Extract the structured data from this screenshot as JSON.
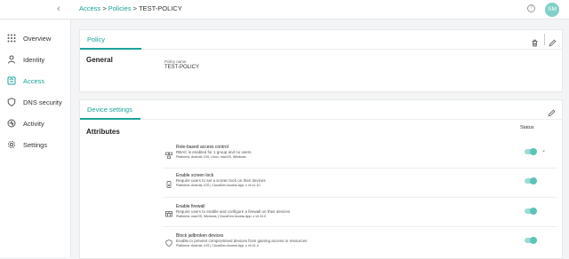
{
  "breadcrumb": {
    "access": "Access",
    "sep1": " > ",
    "policies": "Policies",
    "sep2": " > ",
    "current": "TEST-POLICY"
  },
  "header": {
    "help_icon": "?",
    "avatar_initials": "SM"
  },
  "sidebar": {
    "items": [
      {
        "label": "Overview",
        "icon": "grid-icon"
      },
      {
        "label": "Identity",
        "icon": "person-icon"
      },
      {
        "label": "Access",
        "icon": "access-icon",
        "active": true
      },
      {
        "label": "DNS security",
        "icon": "shield-icon"
      },
      {
        "label": "Activity",
        "icon": "activity-icon"
      },
      {
        "label": "Settings",
        "icon": "gear-icon"
      }
    ]
  },
  "policy_card": {
    "tab": "Policy",
    "section": "General",
    "name_label": "Policy name",
    "name_value": "TEST-POLICY"
  },
  "device_card": {
    "tab": "Device settings",
    "section": "Attributes",
    "status_header": "Status",
    "rows": [
      {
        "title": "Role-based access control",
        "desc": "RBAC is enabled for 1 group and no users",
        "platforms": "Platforms: Android, iOS, Linux, macOS, Windows",
        "enabled": true,
        "expandable": true
      },
      {
        "title": "Enable screen lock",
        "desc": "Require users to set a screen lock on their devices",
        "platforms": "Platforms: Android, iOS   |   CloudGen Access App: ≥ v0.11.10",
        "enabled": true
      },
      {
        "title": "Enable firewall",
        "desc": "Require users to enable and configure a firewall on their devices",
        "platforms": "Platforms: macOS, Windows   |   CloudGen Access App: ≥ v0.24.0",
        "enabled": true
      },
      {
        "title": "Block jailbroken devices",
        "desc": "Enable to prevent compromised devices from gaining access to resources",
        "platforms": "Platforms: Android, iOS   |   CloudGen Access App: ≥ v0.21.0",
        "enabled": true
      }
    ]
  },
  "colors": {
    "accent": "#1aa39a",
    "toggle_on": "#5bc4b9"
  }
}
